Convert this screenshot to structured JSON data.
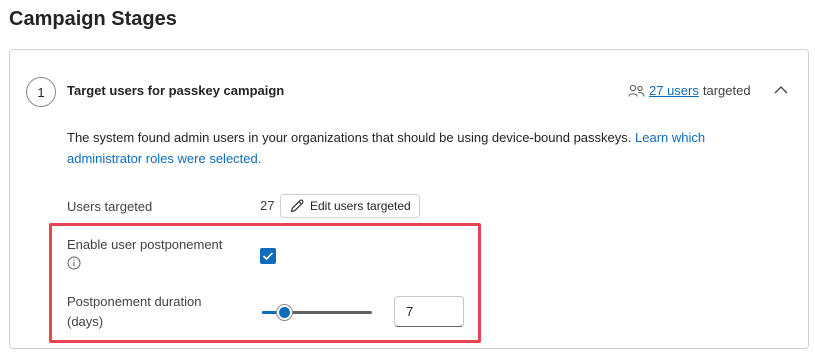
{
  "page": {
    "title": "Campaign Stages"
  },
  "stage": {
    "number": "1",
    "title": "Target users for passkey campaign",
    "users_link": "27 users",
    "targeted_suffix": "targeted",
    "description": "The system found admin users in your organizations that should be using device-bound passkeys.",
    "learn_link": "Learn which administrator roles were selected."
  },
  "form": {
    "users_targeted_label": "Users targeted",
    "users_targeted_count": "27",
    "edit_button_label": "Edit users targeted",
    "postpone_label": "Enable user postponement",
    "postpone_enabled": true,
    "duration_label_line1": "Postponement duration",
    "duration_label_line2": "(days)",
    "duration_value": "7",
    "slider_fraction": 0.2
  },
  "colors": {
    "accent": "#0f6cbd",
    "highlight": "#e8434f"
  }
}
